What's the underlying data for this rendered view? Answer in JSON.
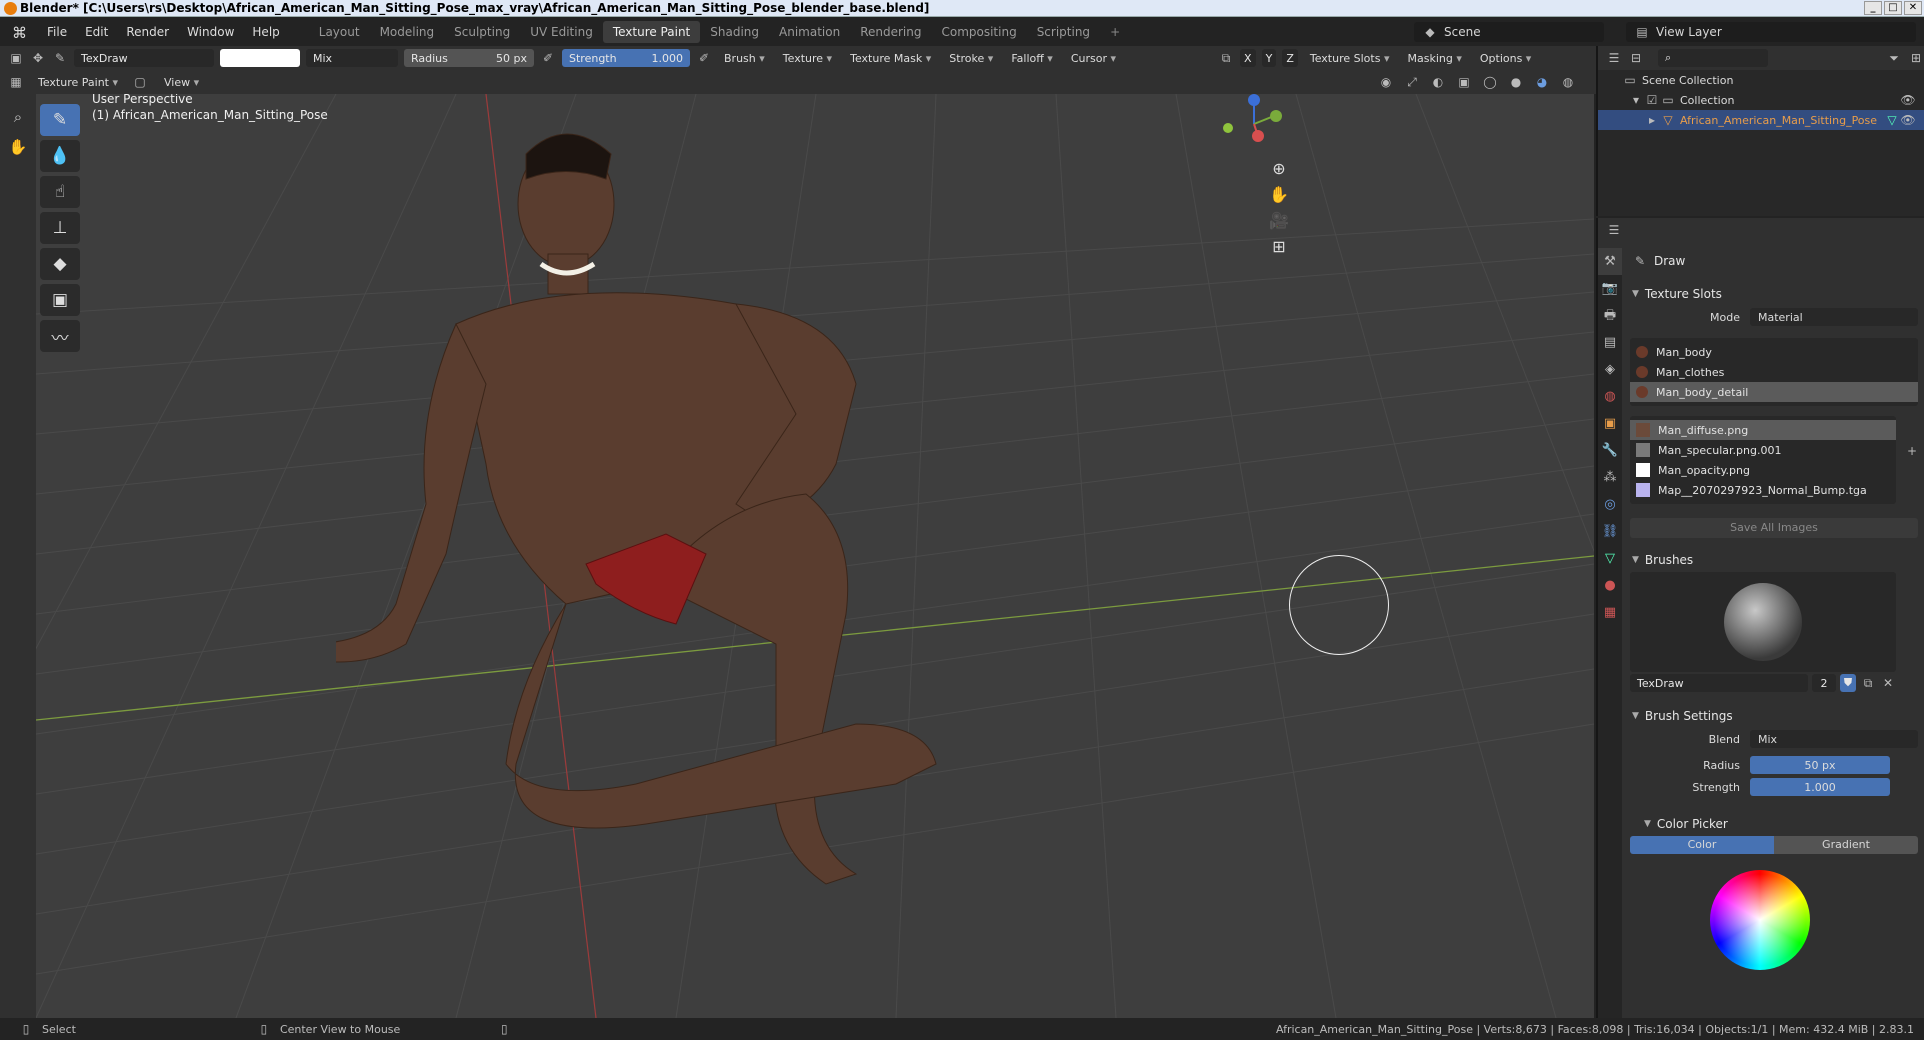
{
  "window": {
    "title": "Blender* [C:\\Users\\rs\\Desktop\\African_American_Man_Sitting_Pose_max_vray\\African_American_Man_Sitting_Pose_blender_base.blend]"
  },
  "menu": [
    "File",
    "Edit",
    "Render",
    "Window",
    "Help"
  ],
  "workspaces": [
    {
      "label": "Layout",
      "active": false
    },
    {
      "label": "Modeling",
      "active": false
    },
    {
      "label": "Sculpting",
      "active": false
    },
    {
      "label": "UV Editing",
      "active": false
    },
    {
      "label": "Texture Paint",
      "active": true
    },
    {
      "label": "Shading",
      "active": false
    },
    {
      "label": "Animation",
      "active": false
    },
    {
      "label": "Rendering",
      "active": false
    },
    {
      "label": "Compositing",
      "active": false
    },
    {
      "label": "Scripting",
      "active": false
    }
  ],
  "scene": {
    "name": "Scene",
    "view_layer": "View Layer"
  },
  "tool_header": {
    "brush_name": "TexDraw",
    "blend": "Mix",
    "radius_label": "Radius",
    "radius_value": "50 px",
    "strength_label": "Strength",
    "strength_value": "1.000",
    "menus": [
      "Brush",
      "Texture",
      "Texture Mask",
      "Stroke",
      "Falloff",
      "Cursor"
    ],
    "axes": [
      "X",
      "Y",
      "Z"
    ],
    "right_menus": [
      "Texture Slots",
      "Masking",
      "Options"
    ]
  },
  "view_header": {
    "mode": "Texture Paint",
    "view": "View"
  },
  "viewport": {
    "perspective": "User Perspective",
    "object": "(1) African_American_Man_Sitting_Pose",
    "gizmo_axes": [
      "Z",
      "Y",
      "X"
    ]
  },
  "outliner": {
    "root": "Scene Collection",
    "collection": "Collection",
    "object": "African_American_Man_Sitting_Pose"
  },
  "properties": {
    "tool_name": "Draw",
    "texture_slots": {
      "title": "Texture Slots",
      "mode_label": "Mode",
      "mode_value": "Material",
      "materials": [
        {
          "name": "Man_body",
          "selected": false
        },
        {
          "name": "Man_clothes",
          "selected": false
        },
        {
          "name": "Man_body_detail",
          "selected": true
        }
      ],
      "images": [
        {
          "name": "Man_diffuse.png",
          "selected": true,
          "swatch": "#6b4a3a"
        },
        {
          "name": "Man_specular.png.001",
          "selected": false,
          "swatch": "#7a7a7a"
        },
        {
          "name": "Man_opacity.png",
          "selected": false,
          "swatch": "#ffffff"
        },
        {
          "name": "Map__2070297923_Normal_Bump.tga",
          "selected": false,
          "swatch": "#b9b3ee"
        }
      ],
      "save_all": "Save All Images"
    },
    "brushes": {
      "title": "Brushes",
      "name": "TexDraw",
      "users": "2"
    },
    "brush_settings": {
      "title": "Brush Settings",
      "blend_label": "Blend",
      "blend_value": "Mix",
      "radius_label": "Radius",
      "radius_value": "50 px",
      "strength_label": "Strength",
      "strength_value": "1.000"
    },
    "color_picker": {
      "title": "Color Picker",
      "tabs": [
        "Color",
        "Gradient"
      ]
    }
  },
  "statusbar": {
    "left": "Select",
    "middle": "Center View to Mouse",
    "stats": "African_American_Man_Sitting_Pose | Verts:8,673 | Faces:8,098 | Tris:16,034 | Objects:1/1 | Mem: 432.4 MiB | 2.83.1"
  },
  "colors": {
    "accent": "#4772b3",
    "selection": "#334d80",
    "header": "#303030",
    "viewport": "#3e3e3e"
  }
}
